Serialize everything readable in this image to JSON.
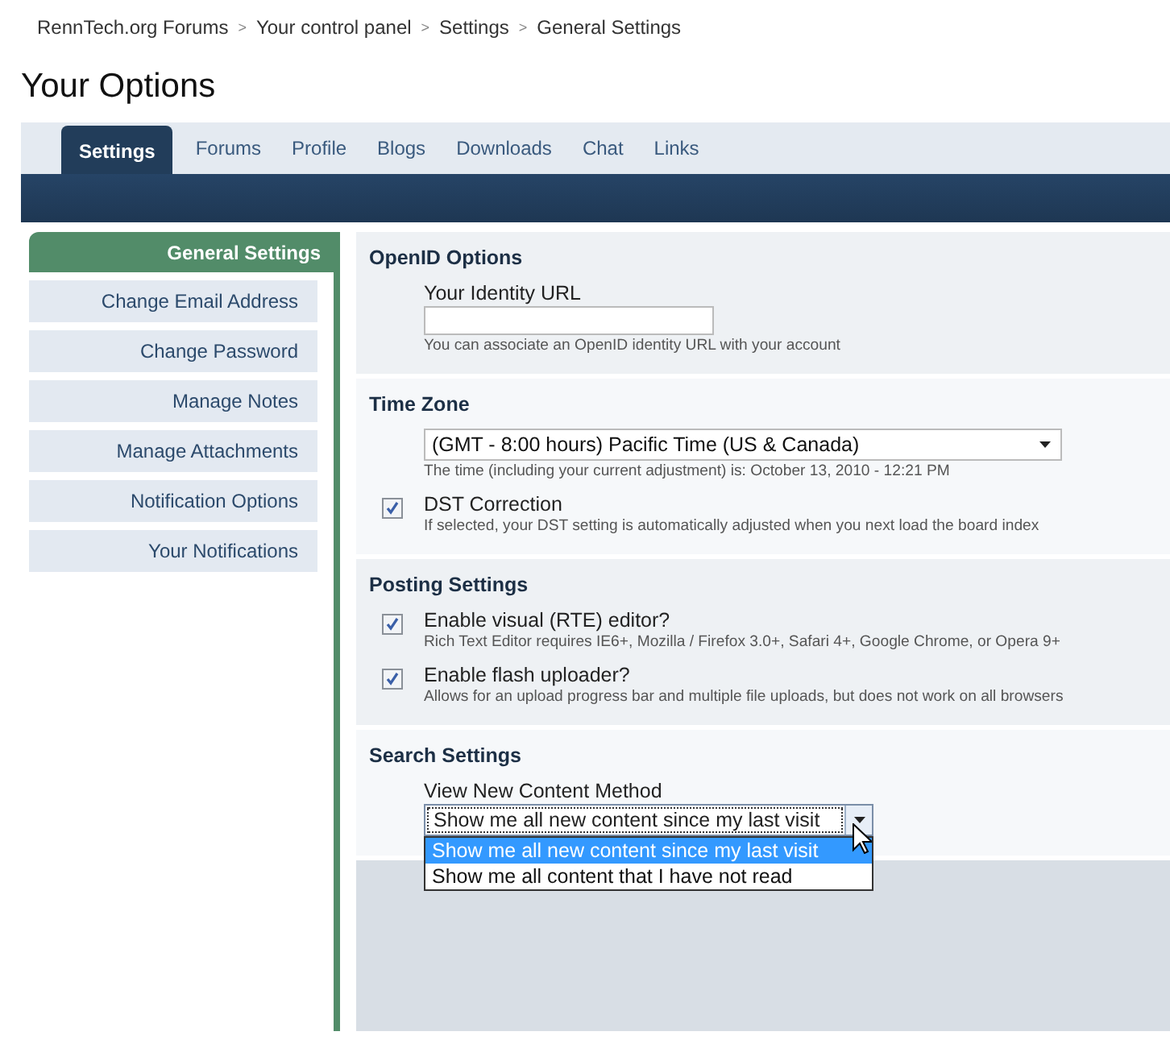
{
  "breadcrumb": [
    {
      "label": "RennTech.org Forums"
    },
    {
      "label": "Your control panel"
    },
    {
      "label": "Settings"
    },
    {
      "label": "General Settings"
    }
  ],
  "breadcrumb_separator": ">",
  "page_title": "Your Options",
  "tabs": [
    {
      "label": "Settings",
      "selected": true
    },
    {
      "label": "Forums",
      "selected": false
    },
    {
      "label": "Profile",
      "selected": false
    },
    {
      "label": "Blogs",
      "selected": false
    },
    {
      "label": "Downloads",
      "selected": false
    },
    {
      "label": "Chat",
      "selected": false
    },
    {
      "label": "Links",
      "selected": false
    }
  ],
  "sidebar": {
    "items": [
      {
        "label": "General Settings",
        "selected": true
      },
      {
        "label": "Change Email Address",
        "selected": false
      },
      {
        "label": "Change Password",
        "selected": false
      },
      {
        "label": "Manage Notes",
        "selected": false
      },
      {
        "label": "Manage Attachments",
        "selected": false
      },
      {
        "label": "Notification Options",
        "selected": false
      },
      {
        "label": "Your Notifications",
        "selected": false
      }
    ]
  },
  "sections": [
    {
      "title": "OpenID Options",
      "fields": [
        {
          "kind": "text",
          "label": "Your Identity URL",
          "hint": "You can associate an OpenID identity URL with your account"
        }
      ]
    },
    {
      "title": "Time Zone",
      "fields": [
        {
          "kind": "select",
          "value": "(GMT - 8:00 hours) Pacific Time (US & Canada)",
          "hint": "The time (including your current adjustment) is: October 13, 2010 - 12:21 PM"
        },
        {
          "kind": "checkbox",
          "label": "DST Correction",
          "checked": true,
          "hint": "If selected, your DST setting is automatically adjusted when you next load the board index"
        }
      ]
    },
    {
      "title": "Posting Settings",
      "fields": [
        {
          "kind": "checkbox",
          "label": "Enable visual (RTE) editor?",
          "checked": true,
          "hint": "Rich Text Editor requires IE6+, Mozilla / Firefox 3.0+, Safari 4+, Google Chrome, or Opera 9+"
        },
        {
          "kind": "checkbox",
          "label": "Enable flash uploader?",
          "checked": true,
          "hint": "Allows for an upload progress bar and multiple file uploads, but does not work on all browsers"
        }
      ]
    },
    {
      "title": "Search Settings",
      "fields": [
        {
          "kind": "dropdown",
          "label": "View New Content Method",
          "value": "Show me all new content since my last visit",
          "expanded": true,
          "options": [
            {
              "label": "Show me all new content since my last visit",
              "selected": true
            },
            {
              "label": "Show me all content that I have not read",
              "selected": false
            }
          ]
        }
      ]
    }
  ]
}
